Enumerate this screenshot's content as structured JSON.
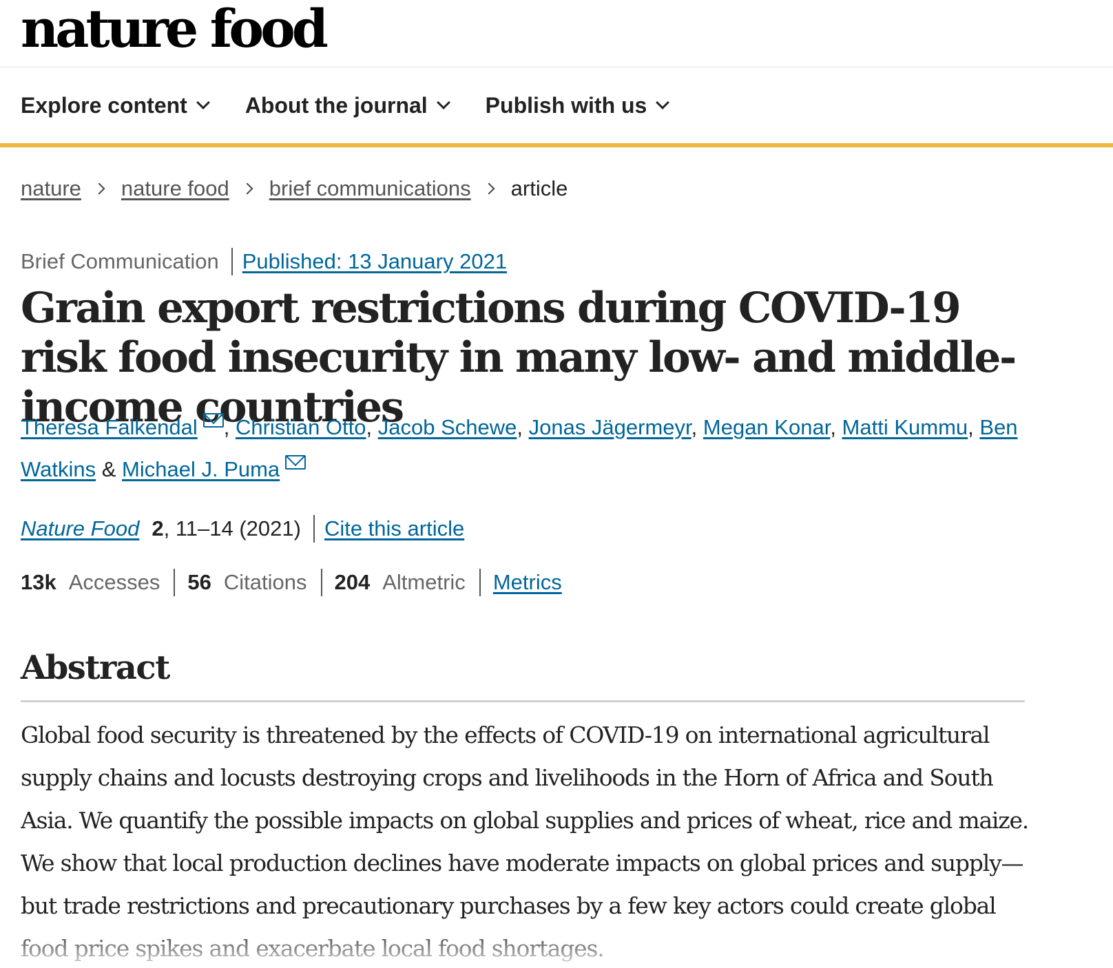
{
  "header": {
    "logo": "nature food"
  },
  "nav": {
    "items": [
      {
        "label": "Explore content"
      },
      {
        "label": "About the journal"
      },
      {
        "label": "Publish with us"
      }
    ],
    "accent_color": "#eeb83a"
  },
  "breadcrumb": {
    "items": [
      "nature",
      "nature food",
      "brief communications"
    ],
    "current": "article"
  },
  "article": {
    "type": "Brief Communication",
    "published": "Published: 13 January 2021",
    "title": "Grain export restrictions during COVID-19 risk food insecurity in many low- and middle-income countries",
    "authors": [
      {
        "name": "Theresa Falkendal",
        "email_icon": true
      },
      {
        "name": "Christian Otto"
      },
      {
        "name": "Jacob Schewe"
      },
      {
        "name": "Jonas Jägermeyr"
      },
      {
        "name": "Megan Konar"
      },
      {
        "name": "Matti Kummu"
      },
      {
        "name": "Ben Watkins"
      },
      {
        "name": "Michael J. Puma",
        "email_icon": true
      }
    ],
    "author_conjunction": "&",
    "journal": "Nature Food",
    "volume": "2",
    "pages_year": ", 11–14 (2021)",
    "cite_label": "Cite this article",
    "metrics": {
      "accesses_value": "13k",
      "accesses_label": "Accesses",
      "citations_value": "56",
      "citations_label": "Citations",
      "altmetric_value": "204",
      "altmetric_label": "Altmetric",
      "metrics_link": "Metrics"
    },
    "abstract_heading": "Abstract",
    "abstract_text": "Global food security is threatened by the effects of COVID-19 on international agricultural supply chains and locusts destroying crops and livelihoods in the Horn of Africa and South Asia. We quantify the possible impacts on global supplies and prices of wheat, rice and maize. We show that local production declines have moderate impacts on global prices and supply—but trade restrictions and precautionary purchases by a few key actors could create global food price spikes and exacerbate local food shortages."
  },
  "colors": {
    "link": "#006699",
    "text": "#222222",
    "muted": "#666666"
  }
}
